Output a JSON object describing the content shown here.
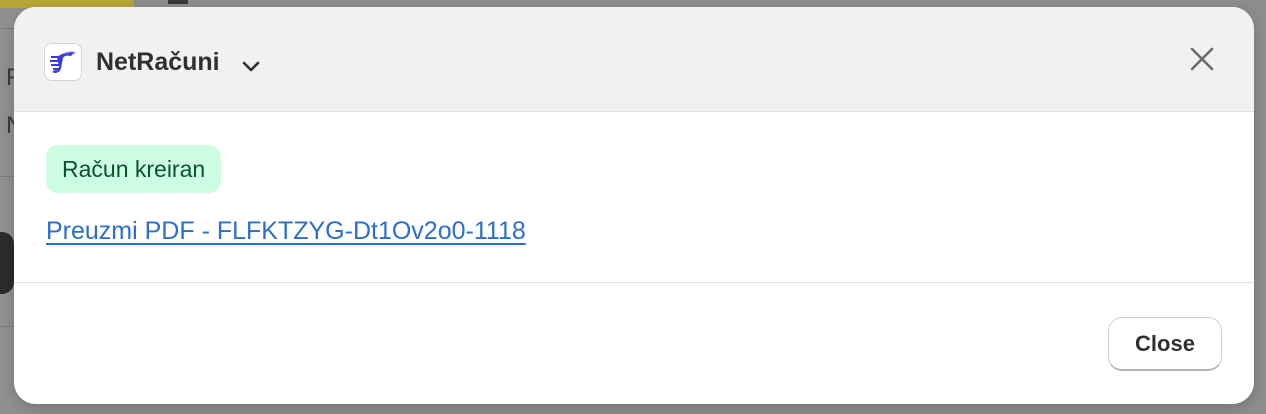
{
  "modal": {
    "app_name": "NetRačuni",
    "badge": "Račun kreiran",
    "pdf_link": "Preuzmi PDF - FLFKTZYG-Dt1Ov2o0-1118",
    "close_button": "Close"
  },
  "background": {
    "letters": [
      "F",
      "N"
    ]
  },
  "colors": {
    "badge_bg": "#cdfee1",
    "badge_text": "#0c5132",
    "link": "#2c6ecb",
    "header_bg": "#f1f1f1",
    "logo_accent": "#3b3bd6"
  },
  "icons": {
    "app_logo": "netracuni-logo",
    "dropdown": "chevron-down-icon",
    "close": "close-icon"
  }
}
